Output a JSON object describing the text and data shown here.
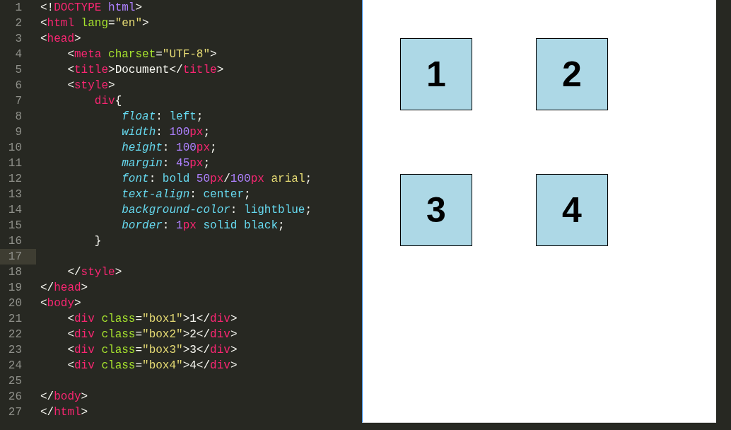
{
  "editor": {
    "lines": [
      {
        "number": "1",
        "current": false,
        "tokens": [
          {
            "kind": "punct",
            "text": "<!"
          },
          {
            "kind": "tag",
            "text": "DOCTYPE"
          },
          {
            "kind": "number",
            "text": " html"
          },
          {
            "kind": "punct",
            "text": ">"
          }
        ]
      },
      {
        "number": "2",
        "current": false,
        "tokens": [
          {
            "kind": "punct",
            "text": "<"
          },
          {
            "kind": "tag",
            "text": "html"
          },
          {
            "kind": "attr",
            "text": " lang"
          },
          {
            "kind": "punct",
            "text": "="
          },
          {
            "kind": "string",
            "text": "\"en\""
          },
          {
            "kind": "punct",
            "text": ">"
          }
        ]
      },
      {
        "number": "3",
        "current": false,
        "tokens": [
          {
            "kind": "punct",
            "text": "<"
          },
          {
            "kind": "tag",
            "text": "head"
          },
          {
            "kind": "punct",
            "text": ">"
          }
        ],
        "children": [
          {
            "number": "4",
            "current": false,
            "tokens": [
              {
                "kind": "punct",
                "text": "<"
              },
              {
                "kind": "tag",
                "text": "meta"
              },
              {
                "kind": "attr",
                "text": " charset"
              },
              {
                "kind": "punct",
                "text": "="
              },
              {
                "kind": "string",
                "text": "\"UTF-8\""
              },
              {
                "kind": "punct",
                "text": ">"
              }
            ]
          },
          {
            "number": "5",
            "current": false,
            "tokens": [
              {
                "kind": "punct",
                "text": "<"
              },
              {
                "kind": "tag",
                "text": "title"
              },
              {
                "kind": "punct",
                "text": ">Document</"
              },
              {
                "kind": "tag",
                "text": "title"
              },
              {
                "kind": "punct",
                "text": ">"
              }
            ]
          },
          {
            "number": "6",
            "current": false,
            "tokens": [
              {
                "kind": "punct",
                "text": "<"
              },
              {
                "kind": "tag",
                "text": "style"
              },
              {
                "kind": "punct",
                "text": ">"
              }
            ],
            "children": [
              {
                "number": "7",
                "current": false,
                "tokens": [
                  {
                    "kind": "tag",
                    "text": "div"
                  },
                  {
                    "kind": "punct",
                    "text": "{"
                  }
                ],
                "children": [
                  {
                    "number": "8",
                    "current": false,
                    "tokens": [
                      {
                        "kind": "prop",
                        "text": "float"
                      },
                      {
                        "kind": "punct",
                        "text": ": "
                      },
                      {
                        "kind": "value",
                        "text": "left"
                      },
                      {
                        "kind": "punct",
                        "text": ";"
                      }
                    ]
                  },
                  {
                    "number": "9",
                    "current": false,
                    "tokens": [
                      {
                        "kind": "prop",
                        "text": "width"
                      },
                      {
                        "kind": "punct",
                        "text": ": "
                      },
                      {
                        "kind": "number",
                        "text": "100"
                      },
                      {
                        "kind": "unit",
                        "text": "px"
                      },
                      {
                        "kind": "punct",
                        "text": ";"
                      }
                    ]
                  },
                  {
                    "number": "10",
                    "current": false,
                    "tokens": [
                      {
                        "kind": "prop",
                        "text": "height"
                      },
                      {
                        "kind": "punct",
                        "text": ": "
                      },
                      {
                        "kind": "number",
                        "text": "100"
                      },
                      {
                        "kind": "unit",
                        "text": "px"
                      },
                      {
                        "kind": "punct",
                        "text": ";"
                      }
                    ]
                  },
                  {
                    "number": "11",
                    "current": false,
                    "tokens": [
                      {
                        "kind": "prop",
                        "text": "margin"
                      },
                      {
                        "kind": "punct",
                        "text": ": "
                      },
                      {
                        "kind": "number",
                        "text": "45"
                      },
                      {
                        "kind": "unit",
                        "text": "px"
                      },
                      {
                        "kind": "punct",
                        "text": ";"
                      }
                    ]
                  },
                  {
                    "number": "12",
                    "current": false,
                    "tokens": [
                      {
                        "kind": "prop",
                        "text": "font"
                      },
                      {
                        "kind": "punct",
                        "text": ": "
                      },
                      {
                        "kind": "value",
                        "text": "bold "
                      },
                      {
                        "kind": "number",
                        "text": "50"
                      },
                      {
                        "kind": "unit",
                        "text": "px"
                      },
                      {
                        "kind": "punct",
                        "text": "/"
                      },
                      {
                        "kind": "number",
                        "text": "100"
                      },
                      {
                        "kind": "unit",
                        "text": "px"
                      },
                      {
                        "kind": "string",
                        "text": " arial"
                      },
                      {
                        "kind": "punct",
                        "text": ";"
                      }
                    ]
                  },
                  {
                    "number": "13",
                    "current": false,
                    "tokens": [
                      {
                        "kind": "prop",
                        "text": "text-align"
                      },
                      {
                        "kind": "punct",
                        "text": ": "
                      },
                      {
                        "kind": "value",
                        "text": "center"
                      },
                      {
                        "kind": "punct",
                        "text": ";"
                      }
                    ]
                  },
                  {
                    "number": "14",
                    "current": false,
                    "tokens": [
                      {
                        "kind": "prop",
                        "text": "background-color"
                      },
                      {
                        "kind": "punct",
                        "text": ": "
                      },
                      {
                        "kind": "value",
                        "text": "lightblue"
                      },
                      {
                        "kind": "punct",
                        "text": ";"
                      }
                    ]
                  },
                  {
                    "number": "15",
                    "current": false,
                    "tokens": [
                      {
                        "kind": "prop",
                        "text": "border"
                      },
                      {
                        "kind": "punct",
                        "text": ": "
                      },
                      {
                        "kind": "number",
                        "text": "1"
                      },
                      {
                        "kind": "unit",
                        "text": "px"
                      },
                      {
                        "kind": "value",
                        "text": " solid black"
                      },
                      {
                        "kind": "punct",
                        "text": ";"
                      }
                    ]
                  }
                ]
              },
              {
                "number": "16",
                "current": false,
                "tokens": [
                  {
                    "kind": "punct",
                    "text": "}"
                  }
                ]
              },
              {
                "number": "17",
                "current": true
              }
            ]
          },
          {
            "number": "18",
            "current": false,
            "tokens": [
              {
                "kind": "punct",
                "text": "</"
              },
              {
                "kind": "tag",
                "text": "style"
              },
              {
                "kind": "punct",
                "text": ">"
              }
            ]
          }
        ]
      },
      {
        "number": "19",
        "current": false,
        "tokens": [
          {
            "kind": "punct",
            "text": "</"
          },
          {
            "kind": "tag",
            "text": "head"
          },
          {
            "kind": "punct",
            "text": ">"
          }
        ]
      },
      {
        "number": "20",
        "current": false,
        "tokens": [
          {
            "kind": "punct",
            "text": "<"
          },
          {
            "kind": "tag",
            "text": "body"
          },
          {
            "kind": "punct",
            "text": ">"
          }
        ],
        "children": [
          {
            "number": "21",
            "current": false,
            "tokens": [
              {
                "kind": "punct",
                "text": "<"
              },
              {
                "kind": "tag",
                "text": "div"
              },
              {
                "kind": "attr",
                "text": " class"
              },
              {
                "kind": "punct",
                "text": "="
              },
              {
                "kind": "string",
                "text": "\"box1\""
              },
              {
                "kind": "punct",
                "text": ">1</"
              },
              {
                "kind": "tag",
                "text": "div"
              },
              {
                "kind": "punct",
                "text": ">"
              }
            ]
          },
          {
            "number": "22",
            "current": false,
            "tokens": [
              {
                "kind": "punct",
                "text": "<"
              },
              {
                "kind": "tag",
                "text": "div"
              },
              {
                "kind": "attr",
                "text": " class"
              },
              {
                "kind": "punct",
                "text": "="
              },
              {
                "kind": "string",
                "text": "\"box2\""
              },
              {
                "kind": "punct",
                "text": ">2</"
              },
              {
                "kind": "tag",
                "text": "div"
              },
              {
                "kind": "punct",
                "text": ">"
              }
            ]
          },
          {
            "number": "23",
            "current": false,
            "tokens": [
              {
                "kind": "punct",
                "text": "<"
              },
              {
                "kind": "tag",
                "text": "div"
              },
              {
                "kind": "attr",
                "text": " class"
              },
              {
                "kind": "punct",
                "text": "="
              },
              {
                "kind": "string",
                "text": "\"box3\""
              },
              {
                "kind": "punct",
                "text": ">3</"
              },
              {
                "kind": "tag",
                "text": "div"
              },
              {
                "kind": "punct",
                "text": ">"
              }
            ]
          },
          {
            "number": "24",
            "current": false,
            "tokens": [
              {
                "kind": "punct",
                "text": "<"
              },
              {
                "kind": "tag",
                "text": "div"
              },
              {
                "kind": "attr",
                "text": " class"
              },
              {
                "kind": "punct",
                "text": "="
              },
              {
                "kind": "string",
                "text": "\"box4\""
              },
              {
                "kind": "punct",
                "text": ">4</"
              },
              {
                "kind": "tag",
                "text": "div"
              },
              {
                "kind": "punct",
                "text": ">"
              }
            ]
          },
          {
            "number": "25",
            "current": false
          }
        ]
      },
      {
        "number": "26",
        "current": false,
        "tokens": [
          {
            "kind": "punct",
            "text": "</"
          },
          {
            "kind": "tag",
            "text": "body"
          },
          {
            "kind": "punct",
            "text": ">"
          }
        ]
      },
      {
        "number": "27",
        "current": false,
        "tokens": [
          {
            "kind": "punct",
            "text": "</"
          },
          {
            "kind": "tag",
            "text": "html"
          },
          {
            "kind": "punct",
            "text": ">"
          }
        ]
      }
    ]
  },
  "preview": {
    "boxes": [
      "1",
      "2",
      "3",
      "4"
    ]
  }
}
